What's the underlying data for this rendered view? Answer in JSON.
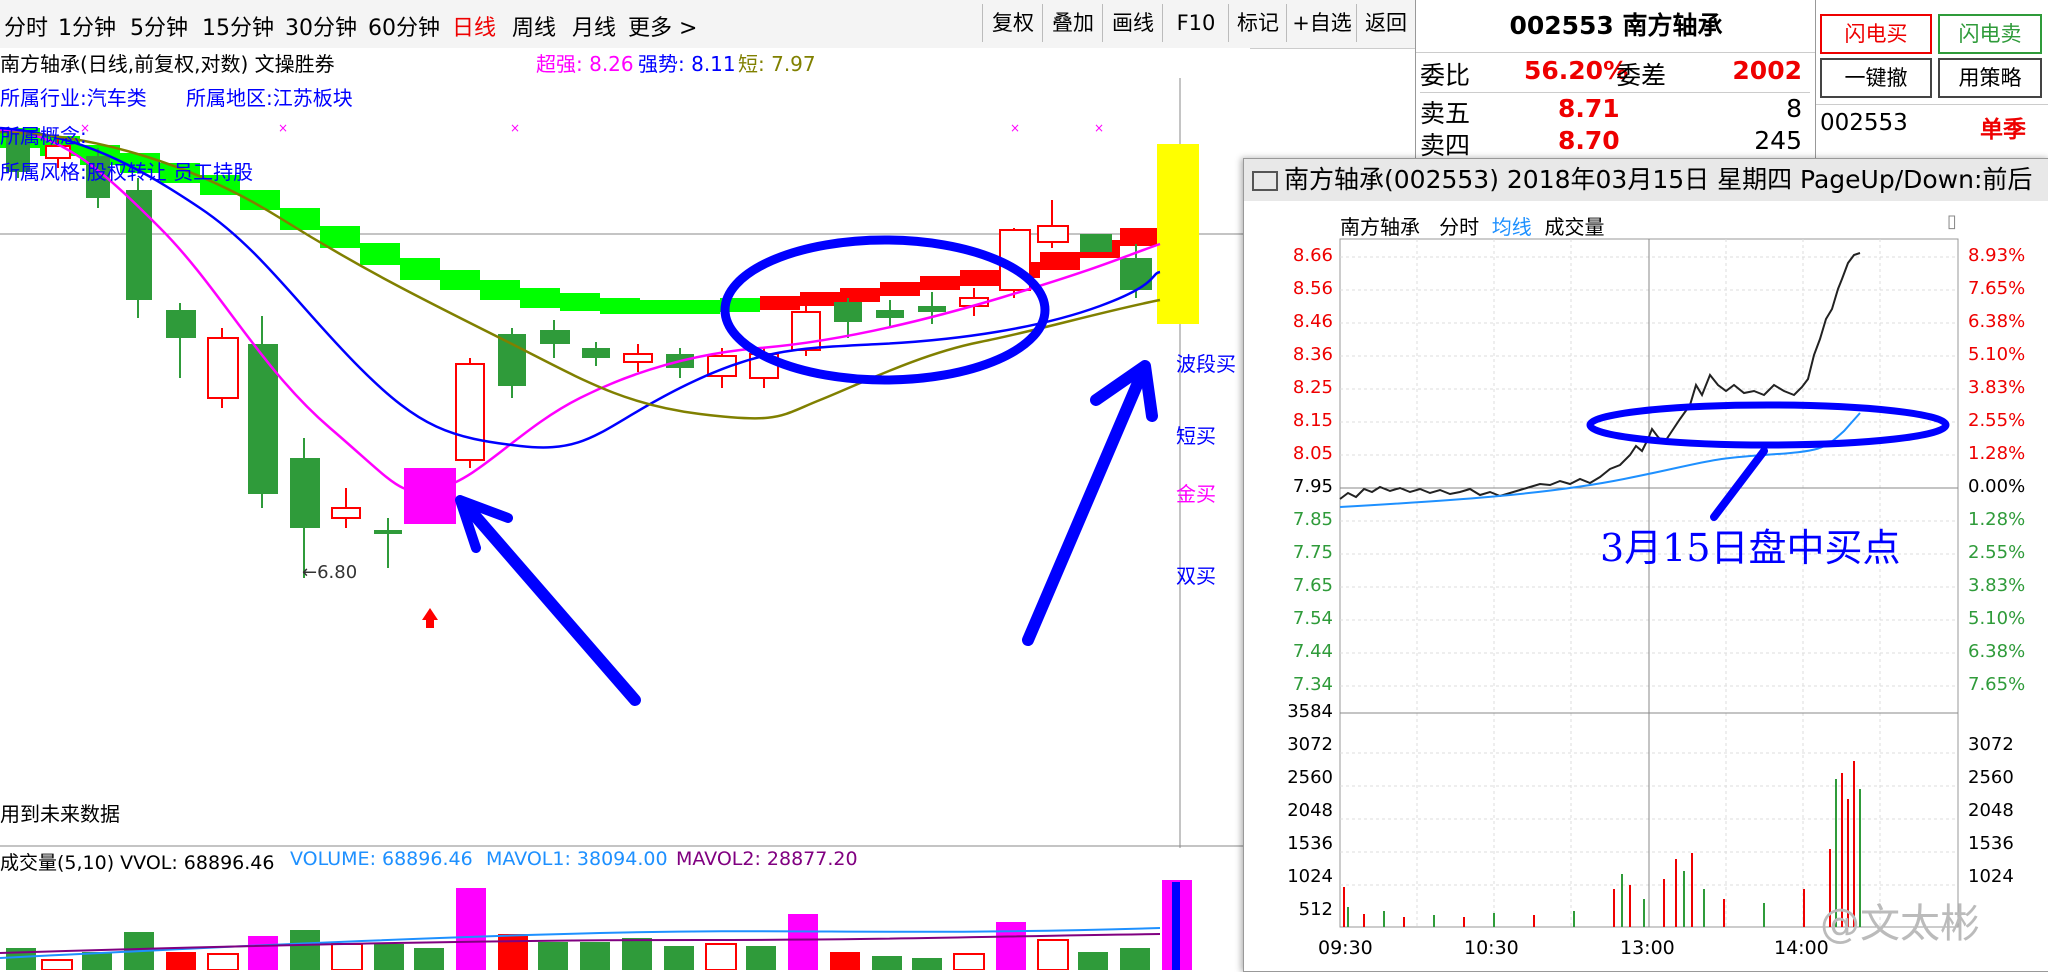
{
  "toolbar": {
    "tabs": [
      "分时",
      "1分钟",
      "5分钟",
      "15分钟",
      "30分钟",
      "60分钟",
      "日线",
      "周线",
      "月线",
      "更多 >"
    ],
    "buttons": [
      "复权",
      "叠加",
      "画线",
      "F10",
      "标记",
      "+自选",
      "返回"
    ]
  },
  "chart": {
    "header": "南方轴承(日线,前复权,对数) 文操胜券",
    "indicators": [
      {
        "label": "超强: 8.26",
        "color": "#ff00ff"
      },
      {
        "label": "强势: 8.11",
        "color": "#0000ff"
      },
      {
        "label": "短: 7.97",
        "color": "#808000"
      }
    ],
    "industry": "所属行业:汽车类",
    "region": "所属地区:江苏板块",
    "concept": "所属概念:",
    "style": "所属风格:股权转让 员工持股",
    "low_label": "←6.80",
    "signals": [
      "波段买",
      "短买",
      "金买",
      "双买"
    ],
    "future_note": "用到未来数据",
    "volume_header": "成交量(5,10)  VVOL: 68896.46",
    "volume_value": "VOLUME: 68896.46",
    "mavol1": "MAVOL1: 38094.00",
    "mavol2": "MAVOL2: 28877.20"
  },
  "quote": {
    "code_name": "002553 南方轴承",
    "weibi_label": "委比",
    "weibi_value": "56.20%",
    "weicha_label": "委差",
    "weicha_value": "2002",
    "rows": [
      {
        "label": "卖五",
        "price": "8.71",
        "vol": "8"
      },
      {
        "label": "卖四",
        "price": "8.70",
        "vol": "245"
      }
    ]
  },
  "trade": {
    "flash_buy": "闪电买",
    "flash_sell": "闪电卖",
    "one_cancel": "一键撤",
    "strategy": "用策略",
    "code": "002553",
    "account": "单季"
  },
  "popup": {
    "title": "南方轴承(002553) 2018年03月15日 星期四 PageUp/Down:前后",
    "subtitle_name": "南方轴承",
    "subtitle_fs": "分时",
    "subtitle_avg": "均线",
    "subtitle_vol": "成交量",
    "price_ticks": [
      "8.66",
      "8.56",
      "8.46",
      "8.36",
      "8.25",
      "8.15",
      "8.05",
      "7.95",
      "7.85",
      "7.75",
      "7.65",
      "7.54",
      "7.44",
      "7.34"
    ],
    "pct_ticks": [
      "8.93%",
      "7.65%",
      "6.38%",
      "5.10%",
      "3.83%",
      "2.55%",
      "1.28%",
      "0.00%",
      "1.28%",
      "2.55%",
      "3.83%",
      "5.10%",
      "6.38%",
      "7.65%"
    ],
    "vol_ticks": [
      "3584",
      "3072",
      "2560",
      "2048",
      "1536",
      "1024",
      "512"
    ],
    "time_ticks": [
      "09:30",
      "10:30",
      "13:00",
      "14:00"
    ],
    "annotation": "3月15日盘中买点",
    "watermark": "@文太彬"
  },
  "colors": {
    "up": "#ff0000",
    "down": "#2f9b3a",
    "ma_magenta": "#ff00ff",
    "ma_blue": "#0000ff",
    "ma_olive": "#808000",
    "annotation": "#0000ff"
  }
}
